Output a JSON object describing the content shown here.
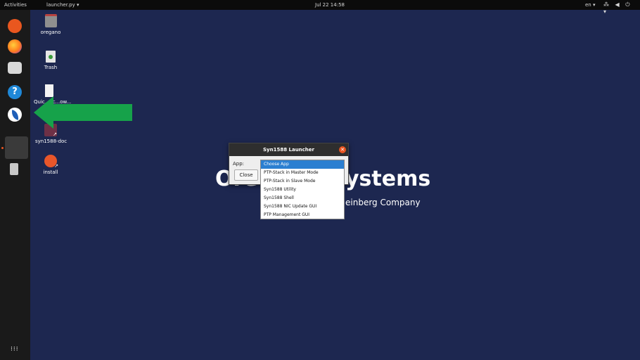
{
  "topbar": {
    "activities": "Activities",
    "app_menu": "launcher.py ▾",
    "clock": "Jul 22  14:58",
    "language": "en ▾",
    "system_icons": "⁂ ◀ ⏻ ▾"
  },
  "dock": {
    "items": [
      "ubuntu-software",
      "firefox",
      "files",
      "help",
      "oregano-launcher",
      "running-app",
      "usb-drive"
    ],
    "help_glyph": "?",
    "apps_glyph": "⁝⁝⁝"
  },
  "desktop": {
    "icons": [
      {
        "label": "oregano"
      },
      {
        "label": "Trash"
      },
      {
        "label": "Quic...ac...ow..."
      },
      {
        "label": "syn1588-doc"
      },
      {
        "label": "install"
      }
    ],
    "brand_left": "Ore",
    "brand_right": "ystems",
    "brand_sub": "einberg Company"
  },
  "dialog": {
    "title": "Syn1588 Launcher",
    "app_label": "App:",
    "close_label": "Close",
    "close_glyph": "✕"
  },
  "dropdown": {
    "options": [
      "Choose App",
      "PTP-Stack in Master Mode",
      "PTP-Stack in Slave Mode",
      "Syn1588 Utility",
      "Syn1588 Shell",
      "Syn1588 NIC Update GUI",
      "PTP Management GUI"
    ],
    "selected_index": 0
  },
  "colors": {
    "wallpaper": "#1d2750",
    "arrow": "#16a24a",
    "selection": "#2b7fd1",
    "accent": "#e95420"
  }
}
